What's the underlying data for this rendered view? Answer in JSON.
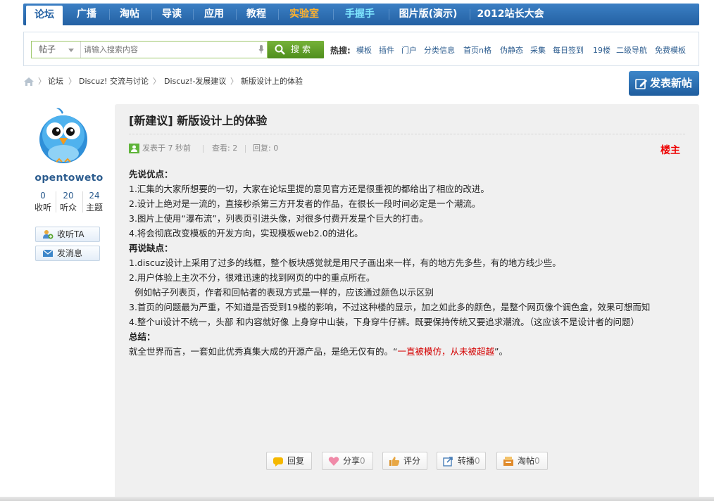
{
  "nav": {
    "items": [
      {
        "label": "论坛",
        "active": true
      },
      {
        "label": "广播"
      },
      {
        "label": "淘帖"
      },
      {
        "label": "导读"
      },
      {
        "label": "应用"
      },
      {
        "label": "教程"
      },
      {
        "label": "实验室",
        "color": "#ffb22e"
      },
      {
        "label": "手握手",
        "color": "#7fe6ff"
      },
      {
        "label": "图片版(演示)"
      },
      {
        "label": "2012站长大会"
      }
    ]
  },
  "search": {
    "category": "帖子",
    "placeholder": "请输入搜索内容",
    "button_label": "搜索",
    "hot_label": "热搜:",
    "hot_links": [
      "模板",
      "插件",
      "门户",
      "分类信息",
      "首页n格",
      "伪静态",
      "采集",
      "每日签到",
      "19楼",
      "二级导航",
      "免费模板"
    ]
  },
  "breadcrumb": {
    "items": [
      "论坛",
      "Discuz! 交流与讨论",
      "Discuz!-发展建议",
      "新版设计上的体验"
    ]
  },
  "post_button_label": "发表新帖",
  "author": {
    "name": "opentoweto",
    "stats": [
      {
        "value": "0",
        "label": "收听"
      },
      {
        "value": "20",
        "label": "听众"
      },
      {
        "value": "24",
        "label": "主题"
      }
    ],
    "follow_label": "收听TA",
    "message_label": "发消息"
  },
  "post": {
    "title": "[新建议] 新版设计上的体验",
    "meta": {
      "posted": "发表于 7 秒前",
      "views": "查看: 2",
      "replies": "回复: 0"
    },
    "floor_label": "楼主",
    "lines": [
      {
        "text": "先说优点：",
        "bold": true
      },
      {
        "text": "1.汇集的大家所想要的一切，大家在论坛里提的意见官方还是很重视的都给出了相应的改进。"
      },
      {
        "text": "2.设计上绝对是一流的，直接秒杀第三方开发者的作品，在很长一段时间必定是一个潮流。"
      },
      {
        "text": "3.图片上使用“瀑布流”，列表页引进头像，对很多付费开发是个巨大的打击。"
      },
      {
        "text": "4.将会彻底改变模板的开发方向，实现模板web2.0的进化。"
      },
      {
        "text": "再说缺点：",
        "bold": true
      },
      {
        "text": "1.discuz设计上采用了过多的线框，整个板块感觉就是用尺子画出来一样，有的地方先多些，有的地方线少些。"
      },
      {
        "text": "2.用户体验上主次不分，很难迅速的找到网页的中的重点所在。"
      },
      {
        "text": "  例如帖子列表页，作者和回帖者的表现方式是一样的，应该通过颜色以示区别"
      },
      {
        "text": "3.首页的问题最为严重，不知道是否受到19楼的影响，不过这种楼的显示，加之如此多的颜色，是整个网页像个调色盒，效果可想而知"
      },
      {
        "text": "4.整个ui设计不统一，头部 和内容就好像 上身穿中山装，下身穿牛仔裤。既要保持传统又要追求潮流。（这应该不是设计者的问题）"
      },
      {
        "text": "总结：",
        "bold": true
      }
    ],
    "conclusion_prefix": "就全世界而言，一套如此优秀真集大成的开源产品，是绝无仅有的。“",
    "conclusion_highlight": "一直被模仿，从未被超越",
    "conclusion_suffix": "”。"
  },
  "actions": [
    {
      "label": "回复",
      "count": "",
      "icon": "reply-icon"
    },
    {
      "label": "分享",
      "count": "0",
      "icon": "heart-icon"
    },
    {
      "label": "评分",
      "count": "",
      "icon": "thumb-icon"
    },
    {
      "label": "转播",
      "count": "0",
      "icon": "forward-icon"
    },
    {
      "label": "淘帖",
      "count": "0",
      "icon": "collect-icon"
    }
  ],
  "colors": {
    "nav_blue": "#2461a3",
    "link_blue": "#2d5d8f",
    "search_green": "#5a9a24",
    "floor_red": "#e00000",
    "highlight_red": "#d40000"
  }
}
